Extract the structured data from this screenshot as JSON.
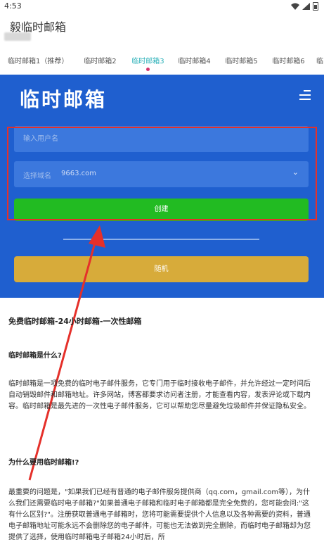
{
  "status_bar": {
    "time": "4:53"
  },
  "app_bar": {
    "title": "毅临时邮箱"
  },
  "tabs": [
    {
      "label": "临时邮箱1（推荐）"
    },
    {
      "label": "临时邮箱2"
    },
    {
      "label": "临时邮箱3"
    },
    {
      "label": "临时邮箱4"
    },
    {
      "label": "临时邮箱5"
    },
    {
      "label": "临时邮箱6"
    },
    {
      "label": "临"
    }
  ],
  "active_tab_index": 2,
  "hero": {
    "logo": "临时邮箱",
    "username_placeholder": "输入用户名",
    "domain_label": "选择域名",
    "domain_value": "9663.com",
    "create_label": "创建",
    "random_label": "随机"
  },
  "article": {
    "title": "免费临时邮箱-24小时邮箱-一次性邮箱",
    "q1": "临时邮箱是什么?",
    "p1": "临时邮箱是一项免费的临时电子邮件服务，它专门用于临时接收电子邮件，并允许经过一定时间后自动销毁邮件和邮箱地址。许多网站，博客都要求访问者注册，才能查看内容，发表评论或下载内容。临时邮箱是最先进的一次性电子邮件服务，它可以帮助您尽量避免垃圾邮件并保证隐私安全。",
    "q2": "为什么要用临时邮箱!?",
    "p2": "最重要的问题是，\"如果我们已经有普通的电子邮件服务提供商（qq.com，gmail.com等），为什么我们还需要临时电子邮箱?\"如果普通电子邮箱和临时电子邮箱都是完全免费的，您可能会问:\"这有什么区别?\"。注册获取普通电子邮箱时，您将可能需要提供个人信息以及各种需要的资料，普通电子邮箱地址可能永远不会删除您的电子邮件，可能也无法做到完全删除，而临时电子邮箱却为您提供了选择，使用临时邮箱电子邮箱24小时后，所"
  },
  "colors": {
    "hero_bg": "#1f5fcf",
    "create_button": "#22bb22",
    "random_button": "#d7ab3a",
    "active_tab": "#2ab0b8",
    "annotation": "#e5302a"
  }
}
